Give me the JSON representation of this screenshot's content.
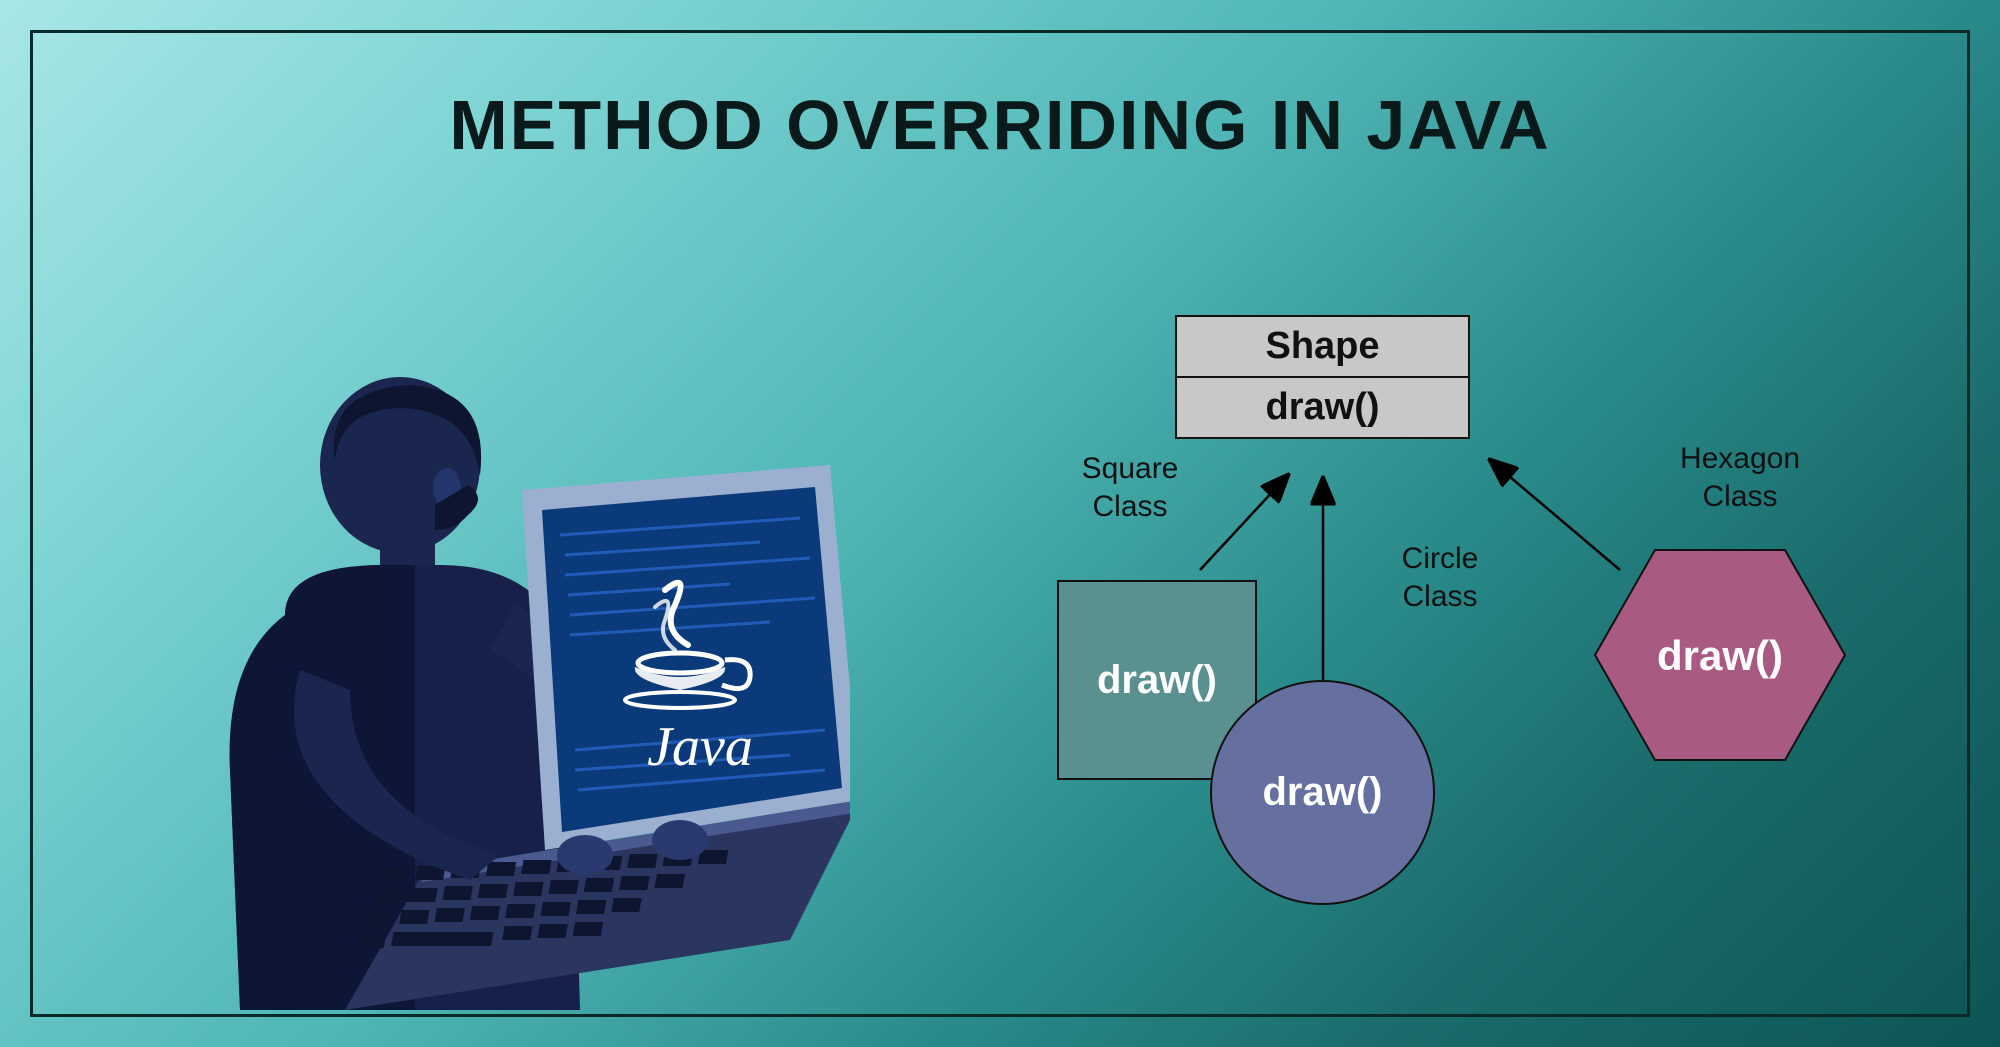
{
  "title": "METHOD OVERRIDING IN JAVA",
  "laptop": {
    "logoText": "Java"
  },
  "parentClass": {
    "name": "Shape",
    "method": "draw()"
  },
  "subclasses": {
    "square": {
      "label": "Square\nClass",
      "method": "draw()"
    },
    "circle": {
      "label": "Circle\nClass",
      "method": "draw()"
    },
    "hexagon": {
      "label": "Hexagon\nClass",
      "method": "draw()"
    }
  }
}
